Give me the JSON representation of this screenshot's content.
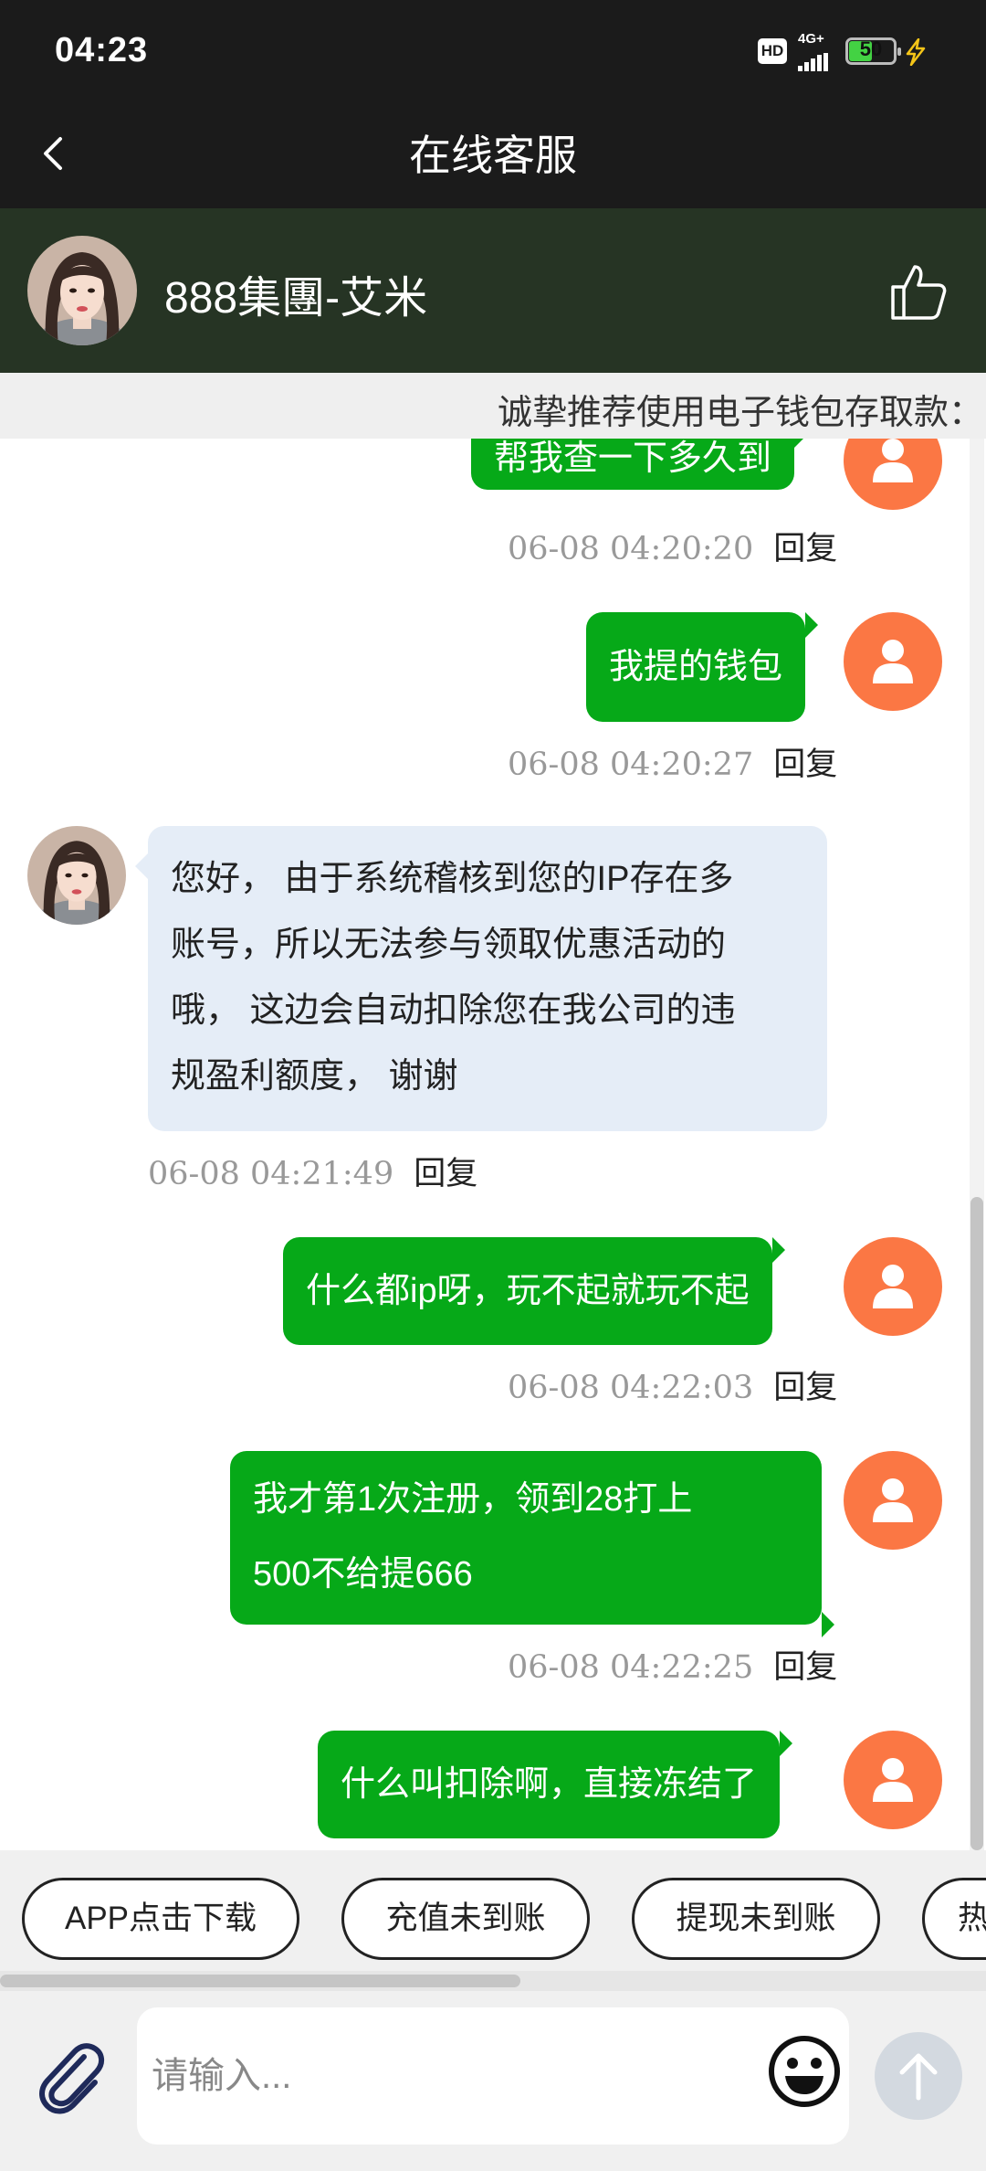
{
  "status_bar": {
    "time": "04:23",
    "hd": "HD",
    "network": "4G+",
    "battery": "50"
  },
  "header": {
    "title": "在线客服"
  },
  "agent": {
    "name": "888集團-艾米"
  },
  "notice": {
    "text": "诚挚推荐使用电子钱包存取款："
  },
  "reply_label": "回复",
  "messages": [
    {
      "side": "out",
      "text": "帮我查一下多久到",
      "time": "06-08 04:20:20"
    },
    {
      "side": "out",
      "text": "我提的钱包",
      "time": "06-08 04:20:27"
    },
    {
      "side": "in",
      "lines": [
        "您好， 由于系统稽核到您的IP存在多",
        "账号，所以无法参与领取优惠活动的",
        "哦， 这边会自动扣除您在我公司的违",
        "规盈利额度， 谢谢"
      ],
      "time": "06-08 04:21:49"
    },
    {
      "side": "out",
      "text": "什么都ip呀，玩不起就玩不起",
      "time": "06-08 04:22:03"
    },
    {
      "side": "out",
      "lines": [
        "我才第1次注册，领到28打上",
        "500不给提666"
      ],
      "time": "06-08 04:22:25"
    },
    {
      "side": "out",
      "text": "什么叫扣除啊，直接冻结了"
    }
  ],
  "quick_replies": [
    "APP点击下载",
    "充值未到账",
    "提现未到账",
    "热"
  ],
  "input": {
    "placeholder": "请输入..."
  },
  "colors": {
    "outgoing_bubble": "#06a918",
    "incoming_bubble": "#e5edf7",
    "user_avatar": "#fb7744",
    "agent_bar": "#263424"
  }
}
